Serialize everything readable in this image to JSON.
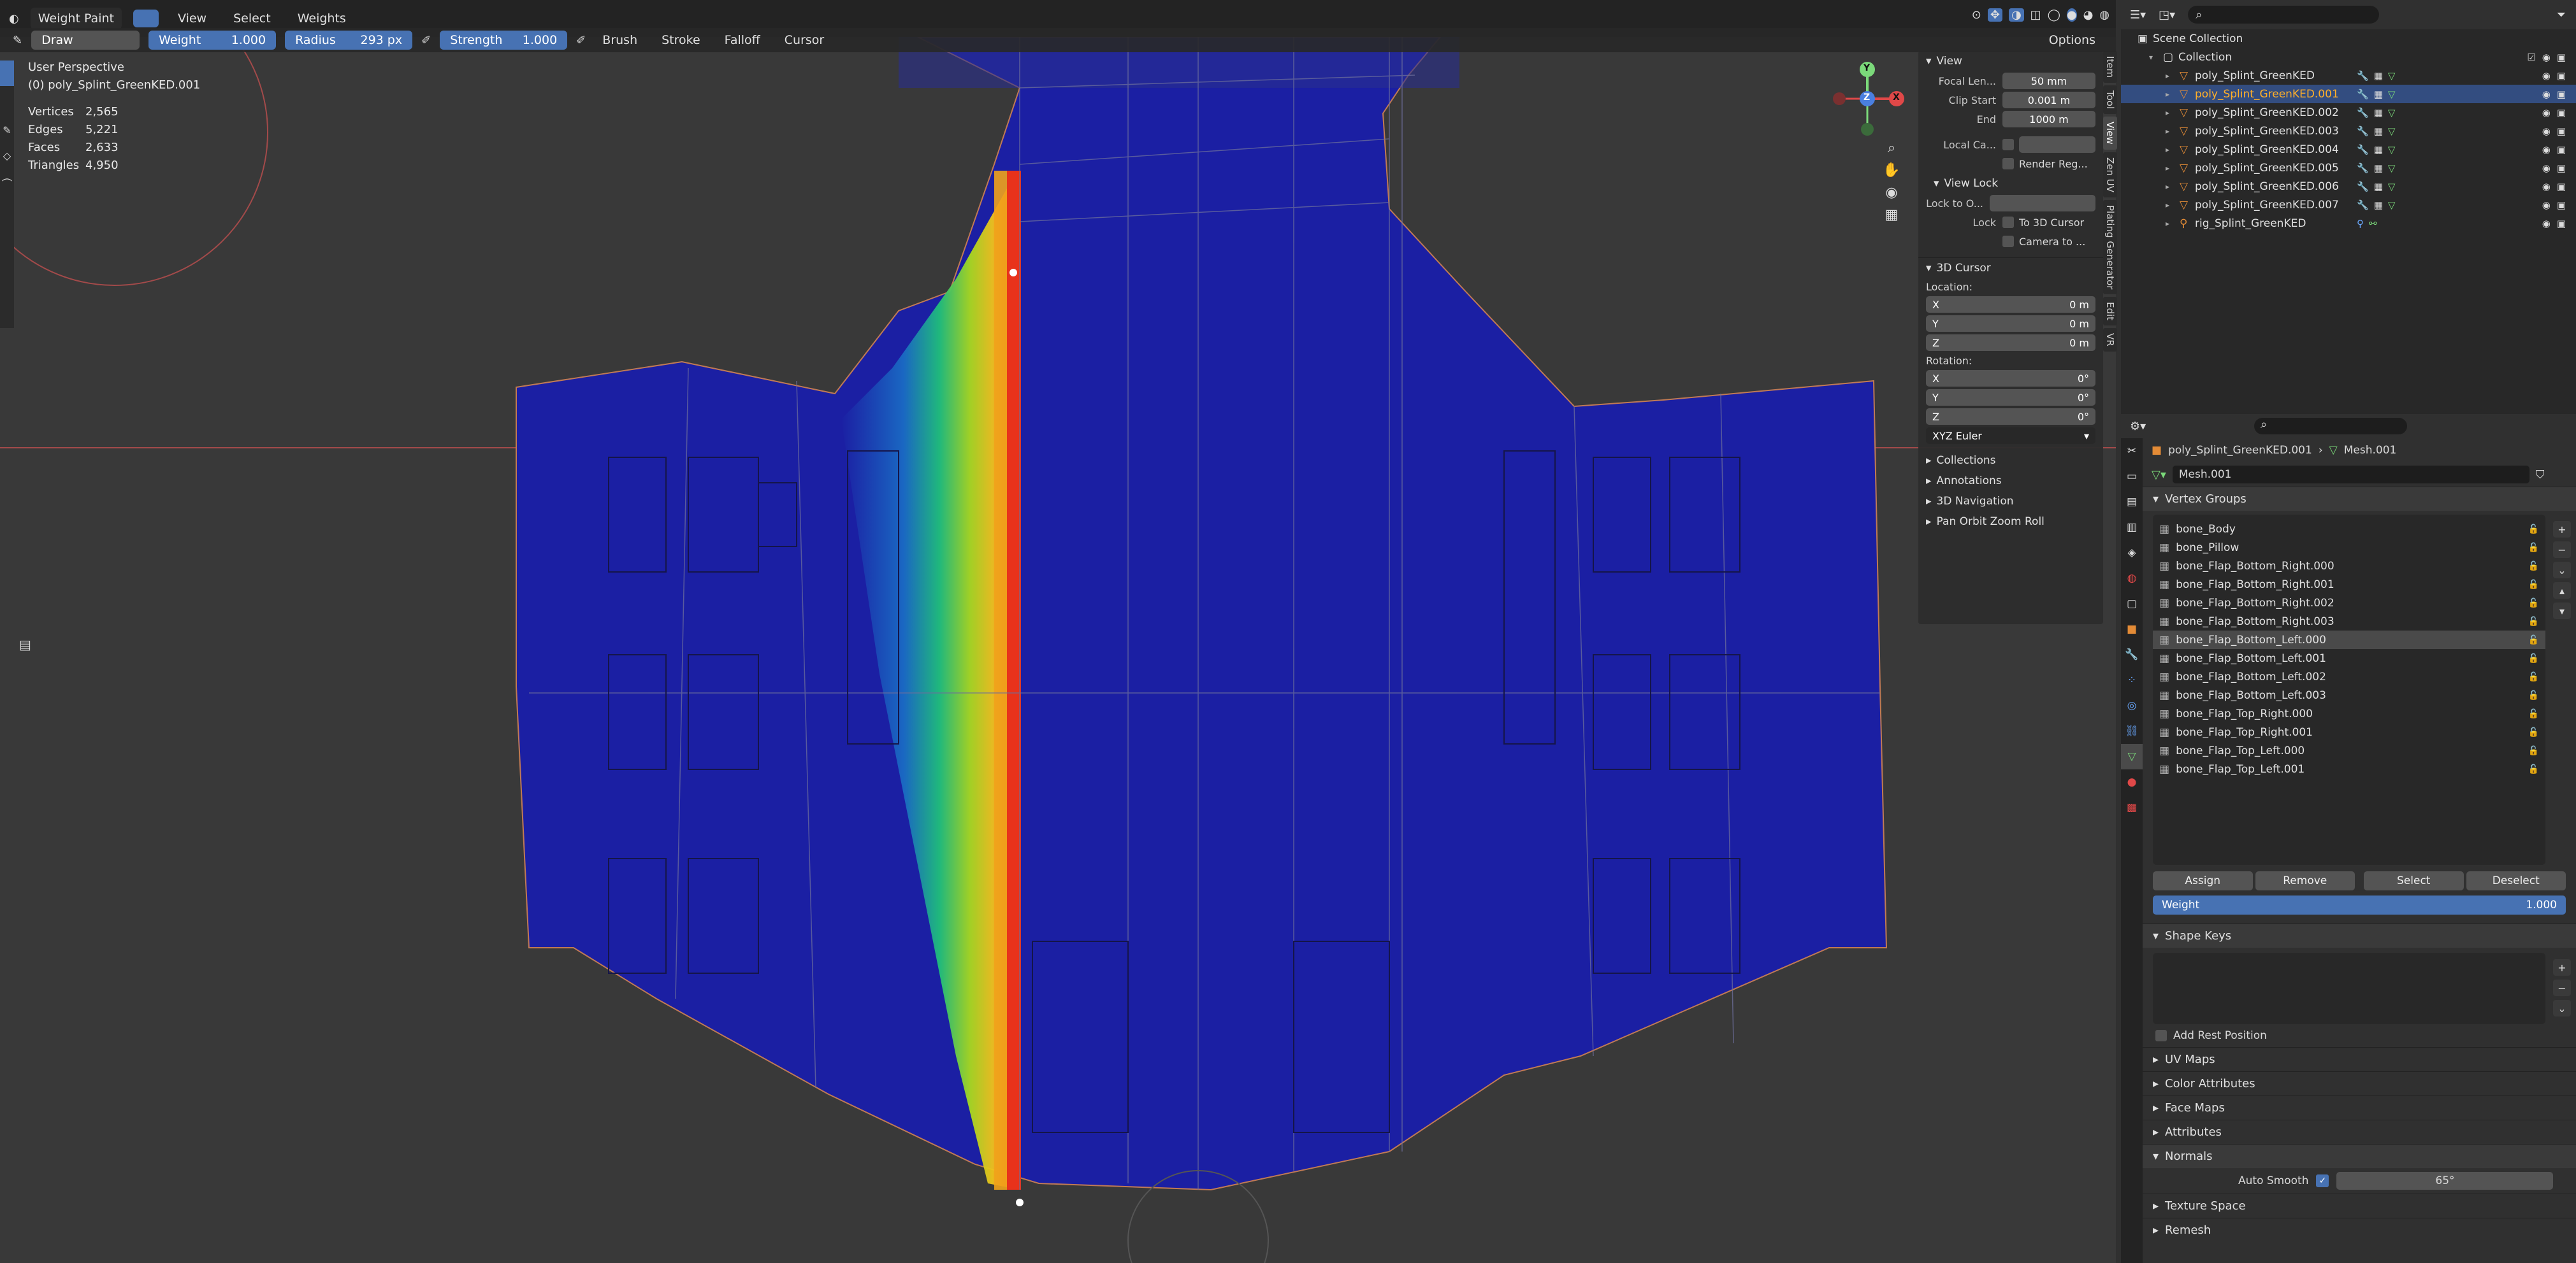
{
  "header": {
    "mode": "Weight Paint",
    "tool": "Draw",
    "menus": [
      "View",
      "Select",
      "Weights"
    ],
    "weight_label": "Weight",
    "weight_value": "1.000",
    "radius_label": "Radius",
    "radius_value": "293 px",
    "strength_label": "Strength",
    "strength_value": "1.000",
    "dropdowns": [
      "Brush",
      "Stroke",
      "Falloff",
      "Cursor"
    ],
    "options": "Options"
  },
  "overlay": {
    "perspective": "User Perspective",
    "object": "(0) poly_Splint_GreenKED.001",
    "stats": [
      {
        "k": "Vertices",
        "v": "2,565"
      },
      {
        "k": "Edges",
        "v": "5,221"
      },
      {
        "k": "Faces",
        "v": "2,633"
      },
      {
        "k": "Triangles",
        "v": "4,950"
      }
    ]
  },
  "gizmo": {
    "x": "X",
    "y": "Y",
    "z": "Z"
  },
  "npanel": {
    "view_title": "View",
    "focal_label": "Focal Len...",
    "focal_value": "50 mm",
    "clip_start_label": "Clip Start",
    "clip_start_value": "0.001 m",
    "end_label": "End",
    "end_value": "1000 m",
    "local_cam_label": "Local Ca...",
    "render_region": "Render Reg...",
    "view_lock_title": "View Lock",
    "lock_to_label": "Lock to O...",
    "lock_label": "Lock",
    "to_3d_cursor": "To 3D Cursor",
    "camera_to": "Camera to ...",
    "cursor_title": "3D Cursor",
    "location_label": "Location:",
    "loc": [
      {
        "k": "X",
        "v": "0 m"
      },
      {
        "k": "Y",
        "v": "0 m"
      },
      {
        "k": "Z",
        "v": "0 m"
      }
    ],
    "rotation_label": "Rotation:",
    "rot": [
      {
        "k": "X",
        "v": "0°"
      },
      {
        "k": "Y",
        "v": "0°"
      },
      {
        "k": "Z",
        "v": "0°"
      }
    ],
    "rot_mode": "XYZ Euler",
    "collapsed": [
      "Collections",
      "Annotations",
      "3D Navigation",
      "Pan Orbit Zoom Roll"
    ]
  },
  "vtabs": [
    "Item",
    "Tool",
    "View",
    "Zen UV",
    "Plating Generator",
    "Edit",
    "VR"
  ],
  "outliner": {
    "scene": "Scene Collection",
    "collection": "Collection",
    "items": [
      "poly_Splint_GreenKED",
      "poly_Splint_GreenKED.001",
      "poly_Splint_GreenKED.002",
      "poly_Splint_GreenKED.003",
      "poly_Splint_GreenKED.004",
      "poly_Splint_GreenKED.005",
      "poly_Splint_GreenKED.006",
      "poly_Splint_GreenKED.007",
      "rig_Splint_GreenKED"
    ]
  },
  "properties": {
    "breadcrumb_object": "poly_Splint_GreenKED.001",
    "breadcrumb_mesh": "Mesh.001",
    "mesh_name": "Mesh.001",
    "vertex_groups_title": "Vertex Groups",
    "vertex_groups": [
      "bone_Body",
      "bone_Pillow",
      "bone_Flap_Bottom_Right.000",
      "bone_Flap_Bottom_Right.001",
      "bone_Flap_Bottom_Right.002",
      "bone_Flap_Bottom_Right.003",
      "bone_Flap_Bottom_Left.000",
      "bone_Flap_Bottom_Left.001",
      "bone_Flap_Bottom_Left.002",
      "bone_Flap_Bottom_Left.003",
      "bone_Flap_Top_Right.000",
      "bone_Flap_Top_Right.001",
      "bone_Flap_Top_Left.000",
      "bone_Flap_Top_Left.001"
    ],
    "assign": "Assign",
    "remove": "Remove",
    "select": "Select",
    "deselect": "Deselect",
    "weight_label": "Weight",
    "weight_value": "1.000",
    "shape_keys_title": "Shape Keys",
    "add_rest_position": "Add Rest Position",
    "uv_maps": "UV Maps",
    "color_attributes": "Color Attributes",
    "face_maps": "Face Maps",
    "attributes": "Attributes",
    "normals": "Normals",
    "auto_smooth_label": "Auto Smooth",
    "auto_smooth_value": "65°",
    "texture_space": "Texture Space",
    "remesh": "Remesh"
  }
}
